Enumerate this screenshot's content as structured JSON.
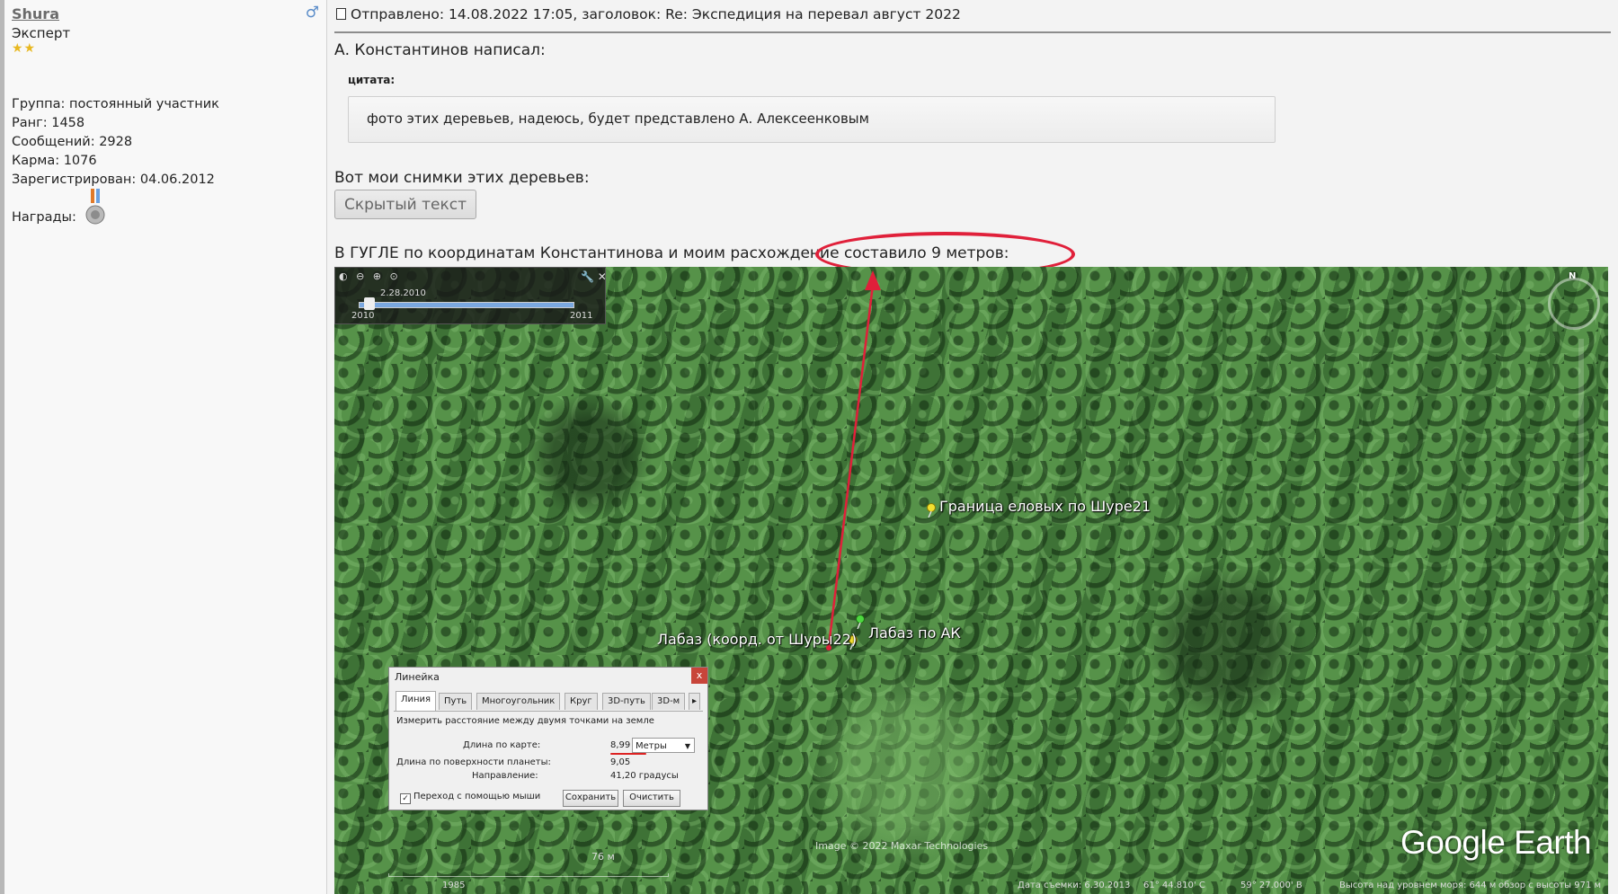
{
  "profile": {
    "username": "Shura",
    "title": "Эксперт",
    "stars": "★★",
    "group": "Группа: постоянный участник",
    "rank": "Ранг: 1458",
    "messages": "Сообщений: 2928",
    "karma": "Карма: 1076",
    "registered": "Зарегистрирован: 04.06.2012",
    "awards_label": "Награды:",
    "gender_symbol": "♂"
  },
  "post": {
    "header": "Отправлено: 14.08.2022 17:05, заголовок: Re: Экспедиция на перевал август 2022",
    "quote_author": "А. Константинов написал:",
    "quote_label": "цитата:",
    "quote_text": "фото этих деревьев, надеюсь, будет представлено А. Алексеенковым",
    "line_photos": "Вот мои снимки этих деревьев:",
    "hidden_button": "Скрытый текст",
    "line_google": "В ГУГЛЕ по координатам Константинова и моим расхождение составило 9 метров:",
    "highlight_color": "#e0203a"
  },
  "map": {
    "time_slider": {
      "date": "2.28.2010",
      "year_start": "2010",
      "year_end": "2011",
      "icons": "◐ ⊖ ⊕ ⊙",
      "tools": "🔧 ✕"
    },
    "compass_label": "N",
    "labels": {
      "boundary": "Граница еловых по Шуре21",
      "shura22": "Лабаз (коорд. от Шуры22)",
      "ak": "Лабаз по АК"
    },
    "ruler": {
      "title": "Линейка",
      "close": "x",
      "tabs": [
        "Линия",
        "Путь",
        "Многоугольник",
        "Круг",
        "3D-путь",
        "3D-м"
      ],
      "tab_arrow": "▸",
      "description": "Измерить расстояние между двумя точками на земле",
      "map_length_label": "Длина по карте:",
      "map_length_value": "8,99",
      "units": "Метры",
      "units_arrow": "▼",
      "surface_label": "Длина по поверхности планеты:",
      "surface_value": "9,05",
      "direction_label": "Направление:",
      "direction_value": "41,20 градусы",
      "mouse_nav": "Переход с помощью мыши",
      "check": "✓",
      "save": "Сохранить",
      "clear": "Очистить"
    },
    "copyright": "Image © 2022 Maxar Technologies",
    "logo": "Google Earth",
    "scale": "76 м",
    "status": {
      "year": "1985",
      "date": "Дата съемки: 6.30.2013",
      "lat": "61° 44.810' С",
      "lon": "59° 27.000' В",
      "alt": "Высота над уровнем моря:  644 м",
      "view": "обзор с высоты  971 м"
    }
  }
}
